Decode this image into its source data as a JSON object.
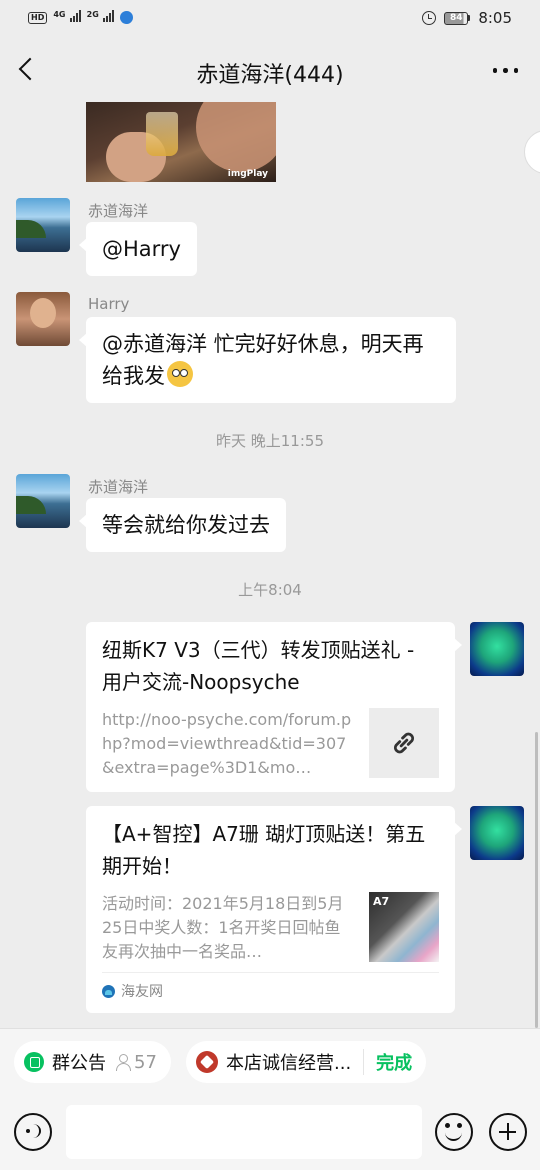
{
  "status_bar": {
    "hd_badge": "HD",
    "net1": "4G",
    "net2": "2G",
    "battery": "84",
    "time": "8:05"
  },
  "header": {
    "title": "赤道海洋(444)"
  },
  "gif": {
    "watermark": "imgPlay"
  },
  "messages": [
    {
      "sender": "赤道海洋",
      "text": "@Harry"
    },
    {
      "sender": "Harry",
      "text": "@赤道海洋  忙完好好休息，明天再给我发"
    },
    {
      "timestamp": "昨天 晚上11:55"
    },
    {
      "sender": "赤道海洋",
      "text": "等会就给你发过去"
    },
    {
      "timestamp": "上午8:04"
    }
  ],
  "cards": [
    {
      "title": "纽斯K7 V3（三代）转发顶贴送礼 - 用户交流-Noopsyche",
      "desc": "http://noo-psyche.com/forum.php?mod=viewthread&tid=307&extra=page%3D1&mo…"
    },
    {
      "title": "【A+智控】A7珊 瑚灯顶贴送！第五期开始！",
      "desc": "活动时间：2021年5月18日到5月25日中奖人数：1名开奖日回帖鱼友再次抽中一名奖品…",
      "thumb_label": "A7",
      "source": "海友网"
    }
  ],
  "chips": {
    "announcement": "群公告",
    "member_count": "57",
    "store": "本店诚信经营...",
    "done": "完成"
  },
  "colors": {
    "accent_green": "#07c160",
    "background": "#ededed"
  },
  "icons": {
    "back": "chevron-left-icon",
    "more": "more-dots-icon",
    "voice": "voice-icon",
    "emoji": "smile-icon",
    "plus": "plus-icon",
    "link": "link-icon"
  }
}
